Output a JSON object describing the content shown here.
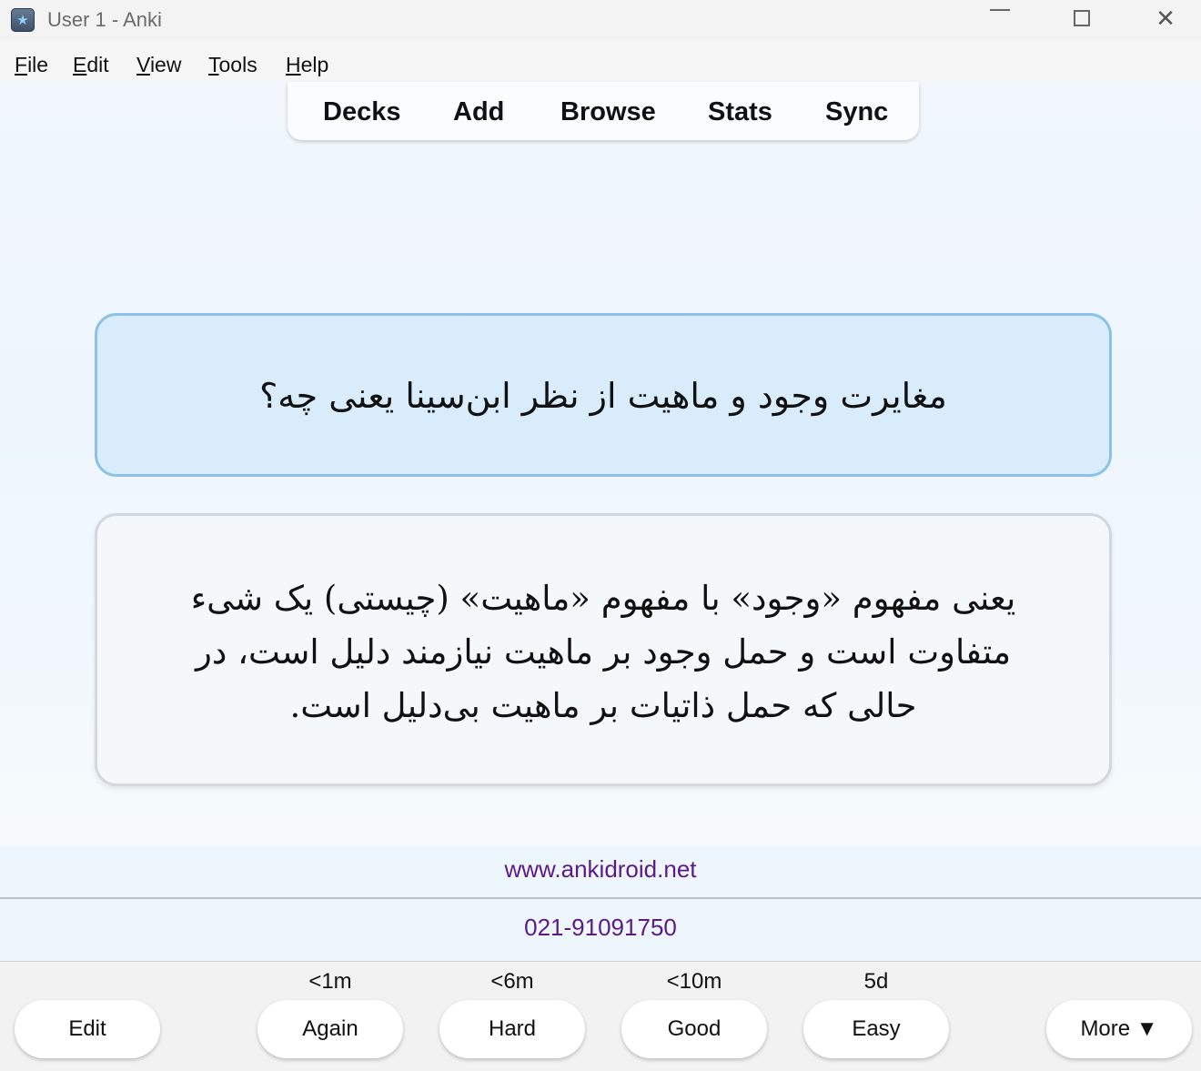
{
  "window": {
    "title": "User 1 - Anki",
    "icon": "anki-star-icon"
  },
  "menu": [
    {
      "mnemonic": "F",
      "rest": "ile"
    },
    {
      "mnemonic": "E",
      "rest": "dit"
    },
    {
      "mnemonic": "V",
      "rest": "iew"
    },
    {
      "mnemonic": "T",
      "rest": "ools"
    },
    {
      "mnemonic": "H",
      "rest": "elp"
    }
  ],
  "toolbar": [
    "Decks",
    "Add",
    "Browse",
    "Stats",
    "Sync"
  ],
  "card": {
    "question": "مغایرت وجود و ماهیت از نظر ابن‌سینا یعنی چه؟",
    "answer": "یعنی مفهوم «وجود» با مفهوم «ماهیت» (چیستی) یک شیء متفاوت است و حمل وجود بر ماهیت نیازمند دلیل است، در حالی که حمل ذاتیات بر ماهیت بی‌دلیل است."
  },
  "footer": {
    "site": "www.ankidroid.net",
    "phone": "021-91091750"
  },
  "answer_bar": {
    "edit": "Edit",
    "more": "More ▼",
    "buttons": [
      {
        "label": "Again",
        "interval": "<1m"
      },
      {
        "label": "Hard",
        "interval": "<6m"
      },
      {
        "label": "Good",
        "interval": "<10m"
      },
      {
        "label": "Easy",
        "interval": "5d"
      }
    ]
  },
  "colors": {
    "question_bg": "#d9ecfb",
    "question_border": "#8cc2e6",
    "link": "#5a1a8a"
  }
}
